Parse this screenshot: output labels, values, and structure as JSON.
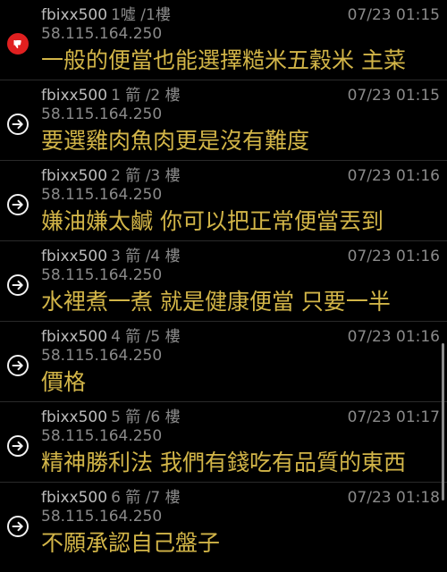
{
  "posts": [
    {
      "user": "fbixx500",
      "floor": "1噓 /1樓",
      "time": "07/23 01:15",
      "ip": "58.115.164.250",
      "content": "一般的便當也能選擇糙米五穀米 主菜",
      "type": "boo",
      "icon": "thumbs-down-icon"
    },
    {
      "user": "fbixx500",
      "floor": "1 箭 /2 樓",
      "time": "07/23 01:15",
      "ip": "58.115.164.250",
      "content": "要選雞肉魚肉更是沒有難度",
      "type": "push",
      "icon": "arrow-right-icon"
    },
    {
      "user": "fbixx500",
      "floor": "2 箭 /3 樓",
      "time": "07/23 01:16",
      "ip": "58.115.164.250",
      "content": "嫌油嫌太鹹 你可以把正常便當丟到",
      "type": "push",
      "icon": "arrow-right-icon"
    },
    {
      "user": "fbixx500",
      "floor": "3 箭 /4 樓",
      "time": "07/23 01:16",
      "ip": "58.115.164.250",
      "content": "水裡煮一煮 就是健康便當 只要一半",
      "type": "push",
      "icon": "arrow-right-icon"
    },
    {
      "user": "fbixx500",
      "floor": "4 箭 /5 樓",
      "time": "07/23 01:16",
      "ip": "58.115.164.250",
      "content": "價格",
      "type": "push",
      "icon": "arrow-right-icon"
    },
    {
      "user": "fbixx500",
      "floor": "5 箭 /6 樓",
      "time": "07/23 01:17",
      "ip": "58.115.164.250",
      "content": "精神勝利法 我們有錢吃有品質的東西",
      "type": "push",
      "icon": "arrow-right-icon"
    },
    {
      "user": "fbixx500",
      "floor": "6 箭 /7 樓",
      "time": "07/23 01:18",
      "ip": "58.115.164.250",
      "content": "不願承認自己盤子",
      "type": "push",
      "icon": "arrow-right-icon"
    }
  ],
  "colors": {
    "background": "#000000",
    "content_text": "#d2b548",
    "meta_text": "#8a8a8a",
    "username_text": "#bdbdbd",
    "boo_badge": "#e02020",
    "push_icon": "#f2f2f2"
  }
}
